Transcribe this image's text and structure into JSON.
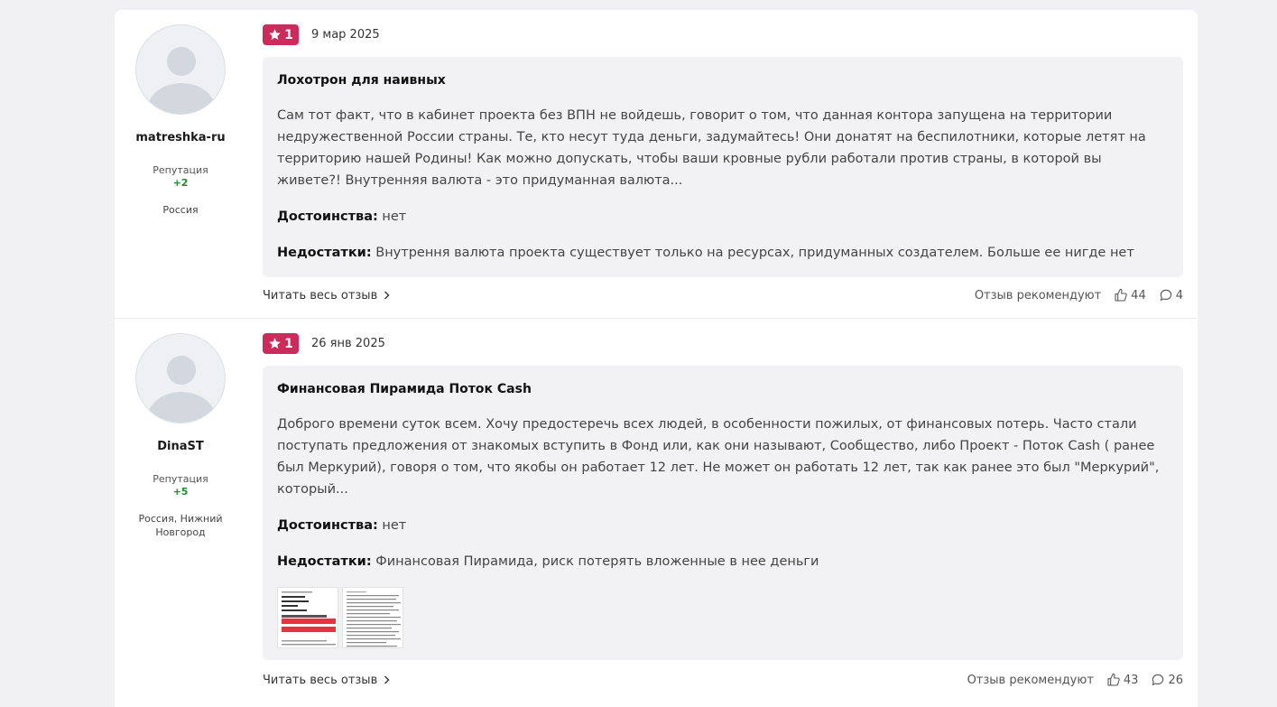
{
  "reviews": [
    {
      "author": {
        "name": "matreshka-ru",
        "reputation_label": "Репутация",
        "reputation": "+2",
        "location": "Россия"
      },
      "rating": "1",
      "date": "9 мар 2025",
      "title": "Лохотрон для наивных",
      "text": "Сам тот факт, что в кабинет проекта без ВПН не войдешь, говорит о том, что данная контора запущена на территории недружественной России страны. Те, кто несут туда деньги, задумайтесь! Они донатят на беспилотники, которые летят на территорию нашей Родины! Как можно допускать, чтобы ваши кровные рубли работали против страны, в которой вы живете?! Внутренняя валюта - это придуманная валюта...",
      "pros_label": "Достоинства:",
      "pros": "нет",
      "cons_label": "Недостатки:",
      "cons": "Внутрення валюта проекта существует только на ресурсах, придуманных создателем. Больше ее нигде нет",
      "read_all": "Читать весь отзыв",
      "recommend_label": "Отзыв рекомендуют",
      "likes": "44",
      "comments": "4"
    },
    {
      "author": {
        "name": "DinaST",
        "reputation_label": "Репутация",
        "reputation": "+5",
        "location": "Россия, Нижний Новгород"
      },
      "rating": "1",
      "date": "26 янв 2025",
      "title": "Финансовая Пирамида Поток Cash",
      "text": "Доброго времени суток всем. Хочу предостеречь всех людей, в особенности пожилых, от финансовых потерь. Часто стали поступать предложения от знакомых вступить в Фонд или, как они называют, Сообщество, либо Проект - Поток Cash ( ранее был Меркурий), говоря о том, что якобы он работает 12 лет. Не может он работать 12 лет, так как ранее это был \"Меркурий\", который...",
      "pros_label": "Достоинства:",
      "pros": "нет",
      "cons_label": "Недостатки:",
      "cons": "Финансовая Пирамида, риск потерять вложенные в нее деньги",
      "read_all": "Читать весь отзыв",
      "recommend_label": "Отзыв рекомендуют",
      "likes": "43",
      "comments": "26"
    }
  ],
  "colors": {
    "rating_badge": "#cc2c5b",
    "reputation": "#1a8d2e",
    "card_bg": "#ffffff",
    "page_bg": "#f1f1f4",
    "text_box_bg": "#f2f2f4"
  },
  "icons": {
    "rating": "star-icon",
    "likes": "thumbs-up-icon",
    "comments": "comment-icon",
    "read_all": "chevron-right-icon"
  }
}
